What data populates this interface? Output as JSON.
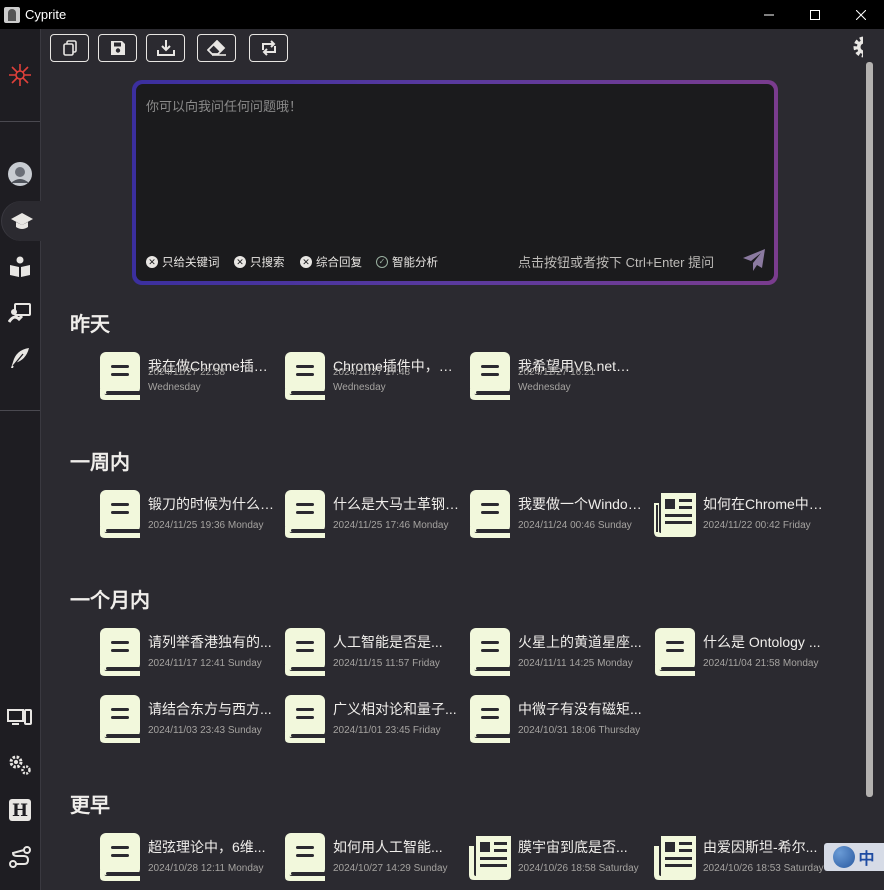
{
  "window": {
    "title": "Cyprite"
  },
  "toolbar": {
    "buttons": [
      "copy-icon",
      "save-icon",
      "download-icon",
      "eraser-icon",
      "refresh-icon"
    ],
    "theme": "gear-icon"
  },
  "query": {
    "placeholder": "你可以向我问任何问题哦！",
    "options": [
      {
        "label": "只给关键词",
        "state": "off"
      },
      {
        "label": "只搜索",
        "state": "off"
      },
      {
        "label": "综合回复",
        "state": "off"
      },
      {
        "label": "智能分析",
        "state": "on"
      }
    ],
    "hint": "点击按钮或者按下 Ctrl+Enter 提问"
  },
  "sections": [
    {
      "title": "昨天",
      "cards": [
        {
          "title": "我在做Chrome插件，...",
          "date": "2024/11/27 22:58",
          "weekday": "Wednesday",
          "icon": "book-icon"
        },
        {
          "title": "Chrome插件中，我...",
          "date": "2024/11/27 17:48",
          "weekday": "Wednesday",
          "icon": "book-icon"
        },
        {
          "title": "我希望用VB.net写一...",
          "date": "2024/11/27 16:21",
          "weekday": "Wednesday",
          "icon": "book-icon"
        }
      ]
    },
    {
      "title": "一周内",
      "cards": [
        {
          "title": "锻刀的时候为什么要...",
          "date": "2024/11/25 19:36 Monday",
          "icon": "book-icon"
        },
        {
          "title": "什么是大马士革钢？...",
          "date": "2024/11/25 17:46 Monday",
          "icon": "book-icon"
        },
        {
          "title": "我要做一个Windows...",
          "date": "2024/11/24 00:46 Sunday",
          "icon": "book-icon"
        },
        {
          "title": "如何在Chrome中实现...",
          "date": "2024/11/22 00:42 Friday",
          "icon": "newspaper-icon"
        }
      ]
    },
    {
      "title": "一个月内",
      "cards": [
        {
          "title": "请列举香港独有的...",
          "date": "2024/11/17 12:41 Sunday",
          "icon": "book-icon"
        },
        {
          "title": "人工智能是否是...",
          "date": "2024/11/15 11:57 Friday",
          "icon": "book-icon"
        },
        {
          "title": "火星上的黄道星座...",
          "date": "2024/11/11 14:25 Monday",
          "icon": "book-icon"
        },
        {
          "title": "什么是 Ontology ...",
          "date": "2024/11/04 21:58 Monday",
          "icon": "book-icon"
        },
        {
          "title": "请结合东方与西方...",
          "date": "2024/11/03 23:43 Sunday",
          "icon": "book-icon"
        },
        {
          "title": "广义相对论和量子...",
          "date": "2024/11/01 23:45 Friday",
          "icon": "book-icon"
        },
        {
          "title": "中微子有没有磁矩...",
          "date": "2024/10/31 18:06 Thursday",
          "icon": "book-icon"
        }
      ]
    },
    {
      "title": "更早",
      "cards": [
        {
          "title": "超弦理论中，6维...",
          "date": "2024/10/28 12:11 Monday",
          "icon": "book-icon"
        },
        {
          "title": "如何用人工智能...",
          "date": "2024/10/27 14:29 Sunday",
          "icon": "book-icon"
        },
        {
          "title": "膜宇宙到底是否...",
          "date": "2024/10/26 18:58 Saturday",
          "icon": "newspaper-icon"
        },
        {
          "title": "由爱因斯坦-希尔...",
          "date": "2024/10/26 18:53 Saturday",
          "icon": "newspaper-icon"
        }
      ]
    }
  ],
  "ime": {
    "lang": "中"
  },
  "colors": {
    "background": "#2b2a30",
    "sidebar": "#1e1d22",
    "card_icon": "#f2f8dc",
    "accent_start": "#3b2f9e",
    "accent_end": "#7a3c8e"
  }
}
